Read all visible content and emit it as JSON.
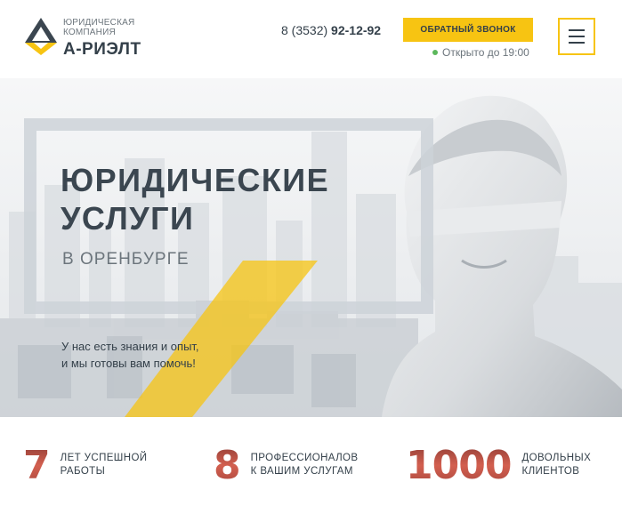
{
  "header": {
    "logo_subtitle": "ЮРИДИЧЕСКАЯ КОМПАНИЯ",
    "logo_name": "А-РИЭЛТ",
    "phone_prefix": "8 (3532)",
    "phone_number": "92-12-92",
    "callback_label": "ОБРАТНЫЙ ЗВОНОК",
    "status_text": "Открыто до 19:00",
    "menu_icon": "hamburger-icon",
    "colors": {
      "accent": "#f7c412",
      "status_dot": "#5cb85c",
      "text": "#34404a"
    }
  },
  "hero": {
    "title_line1": "ЮРИДИЧЕСКИЕ",
    "title_line2": "УСЛУГИ",
    "city": "В ОРЕНБУРГЕ",
    "text_line1": "У нас есть знания и опыт,",
    "text_line2": "и мы готовы вам помочь!"
  },
  "stats": [
    {
      "number": "7",
      "label_line1": "ЛЕТ УСПЕШНОЙ",
      "label_line2": "РАБОТЫ"
    },
    {
      "number": "8",
      "label_line1": "ПРОФЕССИОНАЛОВ",
      "label_line2": "К ВАШИМ УСЛУГАМ"
    },
    {
      "number": "1000",
      "label_line1": "ДОВОЛЬНЫХ",
      "label_line2": "КЛИЕНТОВ"
    }
  ]
}
